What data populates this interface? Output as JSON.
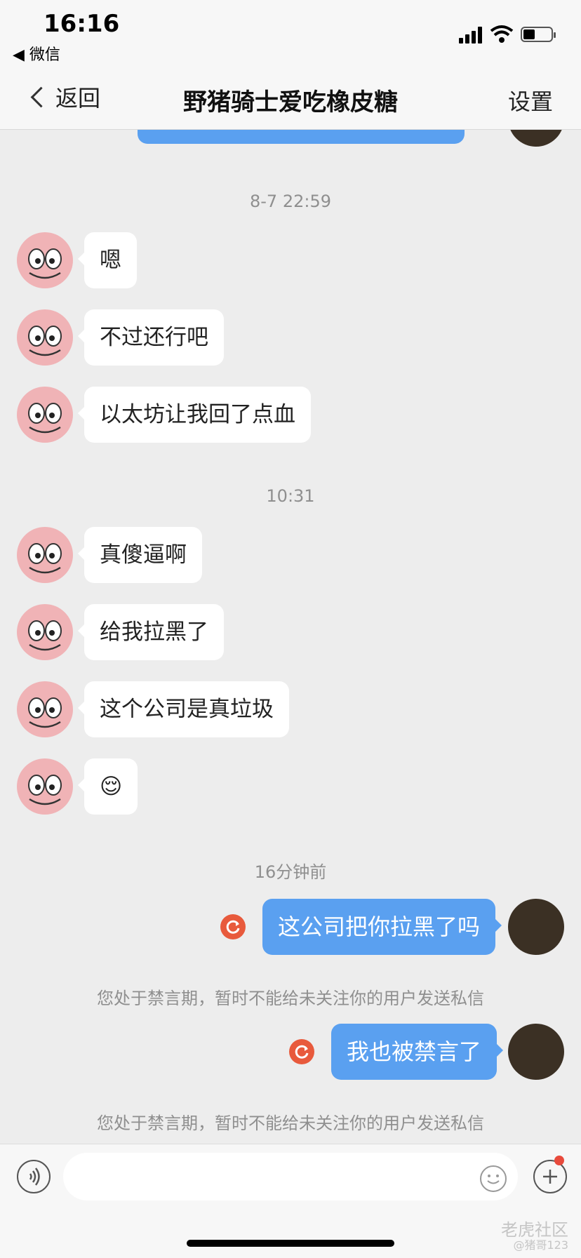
{
  "status_bar": {
    "time": "16:16",
    "back_app": "◀ 微信"
  },
  "nav": {
    "back_label": "返回",
    "title": "野猪骑士爱吃橡皮糖",
    "settings_label": "设置"
  },
  "chat": {
    "timestamps": [
      "8-7 22:59",
      "10:31",
      "16分钟前"
    ],
    "incoming": [
      "嗯",
      "不过还行吧",
      "以太坊让我回了点血",
      "真傻逼啊",
      "给我拉黑了",
      "这个公司是真垃圾",
      "😌"
    ],
    "outgoing": [
      "这公司把你拉黑了吗",
      "我也被禁言了"
    ],
    "notice": "您处于禁言期，暂时不能给未关注你的用户发送私信"
  },
  "input": {
    "placeholder": ""
  },
  "watermark": {
    "brand": "老虎社区",
    "user": "@猪哥123"
  }
}
